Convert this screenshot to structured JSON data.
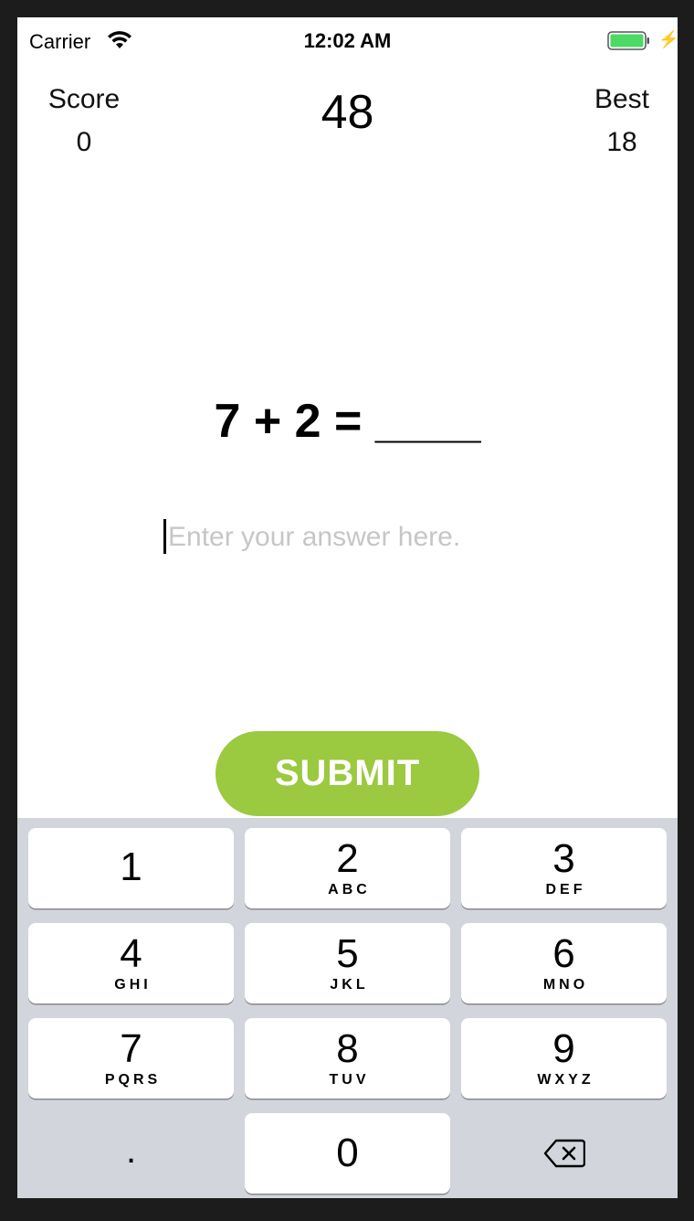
{
  "status_bar": {
    "carrier": "Carrier",
    "time": "12:02 AM",
    "battery_color": "#4cd964"
  },
  "header": {
    "score_label": "Score",
    "score_value": "0",
    "timer": "48",
    "best_label": "Best",
    "best_value": "18"
  },
  "question": {
    "text": "7 + 2 = ____"
  },
  "answer": {
    "value": "",
    "placeholder": "Enter your answer here."
  },
  "submit": {
    "label": "SUBMIT",
    "color": "#9bc93f"
  },
  "keypad": {
    "keys": [
      {
        "digit": "1",
        "letters": ""
      },
      {
        "digit": "2",
        "letters": "ABC"
      },
      {
        "digit": "3",
        "letters": "DEF"
      },
      {
        "digit": "4",
        "letters": "GHI"
      },
      {
        "digit": "5",
        "letters": "JKL"
      },
      {
        "digit": "6",
        "letters": "MNO"
      },
      {
        "digit": "7",
        "letters": "PQRS"
      },
      {
        "digit": "8",
        "letters": "TUV"
      },
      {
        "digit": "9",
        "letters": "WXYZ"
      },
      {
        "digit": "0",
        "letters": ""
      }
    ],
    "decimal": ".",
    "delete_icon": "backspace-icon"
  }
}
